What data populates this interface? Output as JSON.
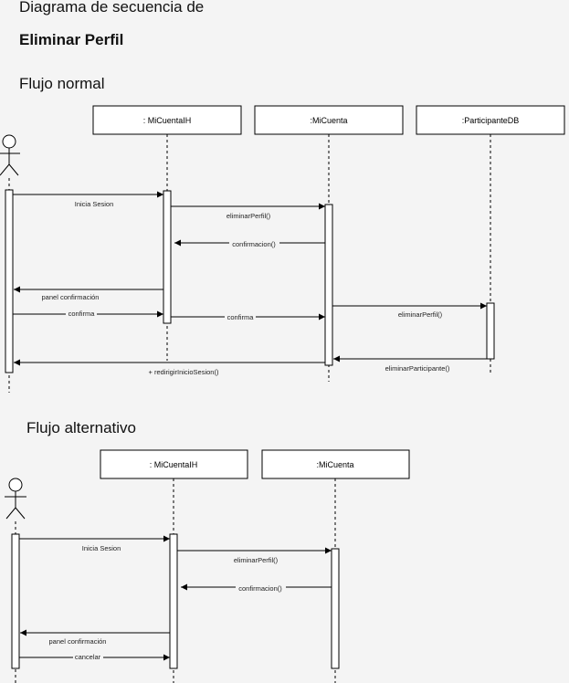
{
  "title": "Diagrama de secuencia de",
  "subtitle": "Eliminar Perfil",
  "normal": {
    "heading": "Flujo normal",
    "lifelines": [
      ": MiCuentaIH",
      ":MiCuenta",
      ":ParticipanteDB"
    ],
    "messages": [
      "Inicia Sesion",
      "eliminarPerfil()",
      "confirmacion()",
      "panel confirmación",
      "confirma",
      "confirma",
      "eliminarPerfil()",
      "+ redirigirInicioSesion()",
      "eliminarParticipante()"
    ]
  },
  "alt": {
    "heading": "Flujo alternativo",
    "lifelines": [
      ": MiCuentaIH",
      ":MiCuenta"
    ],
    "messages": [
      "Inicia Sesion",
      "eliminarPerfil()",
      "confirmacion()",
      "panel confirmación",
      "cancelar"
    ]
  }
}
